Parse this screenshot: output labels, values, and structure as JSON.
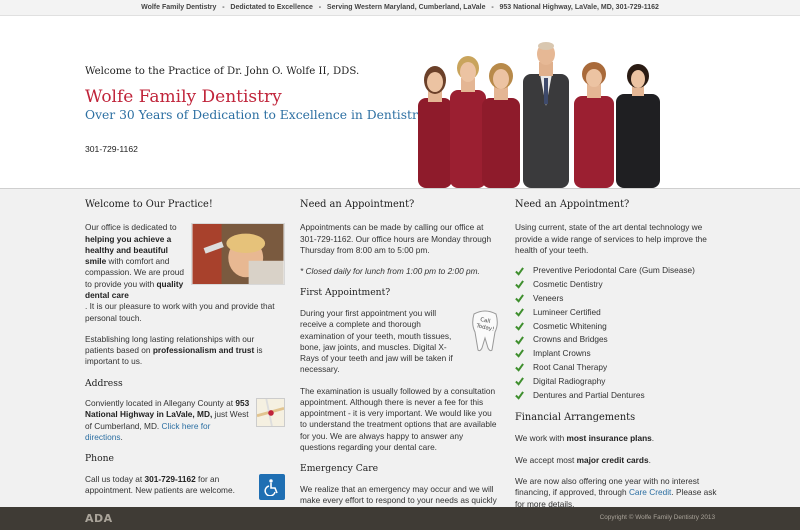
{
  "topbar": {
    "text": "Wolfe Family Dentistry   -   Dedictated to Excellence   -   Serving Western Maryland, Cumberland, LaVale   -   953 National Highway, LaVale, MD, 301-729-1162"
  },
  "hero": {
    "welcome": "Welcome to the Practice of Dr. John O. Wolfe II, DDS.",
    "brand": "Wolfe Family Dentistry",
    "tagline": "Over 30 Years of Dedication to Excellence in Dentistry",
    "phone": "301-729-1162"
  },
  "col1": {
    "title": "Welcome to Our Practice!",
    "intro_a": "Our office is dedicated to ",
    "intro_b1": "helping you achieve a healthy and beautiful smile",
    "intro_c": " with comfort and compassion. We are proud to provide you with ",
    "intro_b2": "quality dental care",
    "intro_d": ". It is our pleasure to work with you and provide that personal touch.",
    "relation_a": "Establishing long lasting relationships with our patients based on ",
    "relation_b": "professionalism and trust",
    "relation_c": " is important to us.",
    "address_title": "Address",
    "address_a": "Conviently located in Allegany County at ",
    "address_b": "953 National Highway in LaVale, MD,",
    "address_c": " just West of Cumberland, MD. ",
    "address_link": "Click here for directions",
    "address_end": ".",
    "phone_title": "Phone",
    "phone_a": "Call us today at ",
    "phone_b": "301-729-1162",
    "phone_c": " for an appointment. New patients are welcome."
  },
  "col2": {
    "title": "Need an Appointment?",
    "p1": "Appointments can be made by calling our office at 301-729-1162. Our office hours are Monday through Thursday from 8:00 am to 5:00 pm.",
    "note": "* Closed daily for lunch from 1:00 pm to 2:00 pm.",
    "first_title": "First Appointment?",
    "first_p": "During your first appointment you will receive a complete and thorough examination of your teeth, mouth tissues, bone, jaw joints, and muscles. Digital X-Rays of your teeth and jaw will be taken if necessary.",
    "tooth_label_1": "Call",
    "tooth_label_2": "Today!",
    "consult_p": "The examination is usually followed by a consultation appointment. Although there is never a fee for this appointment - it is very important. We would like you to understand the treatment options that are available for you. We are always happy to answer any questions regarding your dental care.",
    "emergency_title": "Emergency Care",
    "emergency_p": "We realize that an emergency may occur and we will make every effort to respond to your needs as quickly as possible."
  },
  "col3": {
    "title": "Need an Appointment?",
    "intro": "Using current, state of the art dental technology we provide a wide range of services to help improve the health of your teeth.",
    "services": [
      "Preventive Periodontal Care (Gum Disease)",
      "Cosmetic Dentistry",
      "Veneers",
      "Lumineer Certified",
      "Cosmetic Whitening",
      "Crowns and Bridges",
      "Implant Crowns",
      "Root Canal Therapy",
      "Digital Radiography",
      "Dentures and Partial Dentures"
    ],
    "financial_title": "Financial Arrangements",
    "fin1_a": "We work with ",
    "fin1_b": "most insurance plans",
    "fin1_c": ".",
    "fin2_a": "We accept most ",
    "fin2_b": "major credit cards",
    "fin2_c": ".",
    "fin3_a": "We are now also offering one year with no interest financing, if approved, through ",
    "fin3_link": "Care Credit",
    "fin3_c": ". Please ask for more details."
  },
  "footer": {
    "logo": "ADA",
    "copyright": "Copyright © Wolfe Family Dentistry 2013"
  },
  "colors": {
    "brand": "#c0243a",
    "tagline": "#2c6fa2",
    "check": "#3f8f2e",
    "footer": "#3f3b35"
  }
}
